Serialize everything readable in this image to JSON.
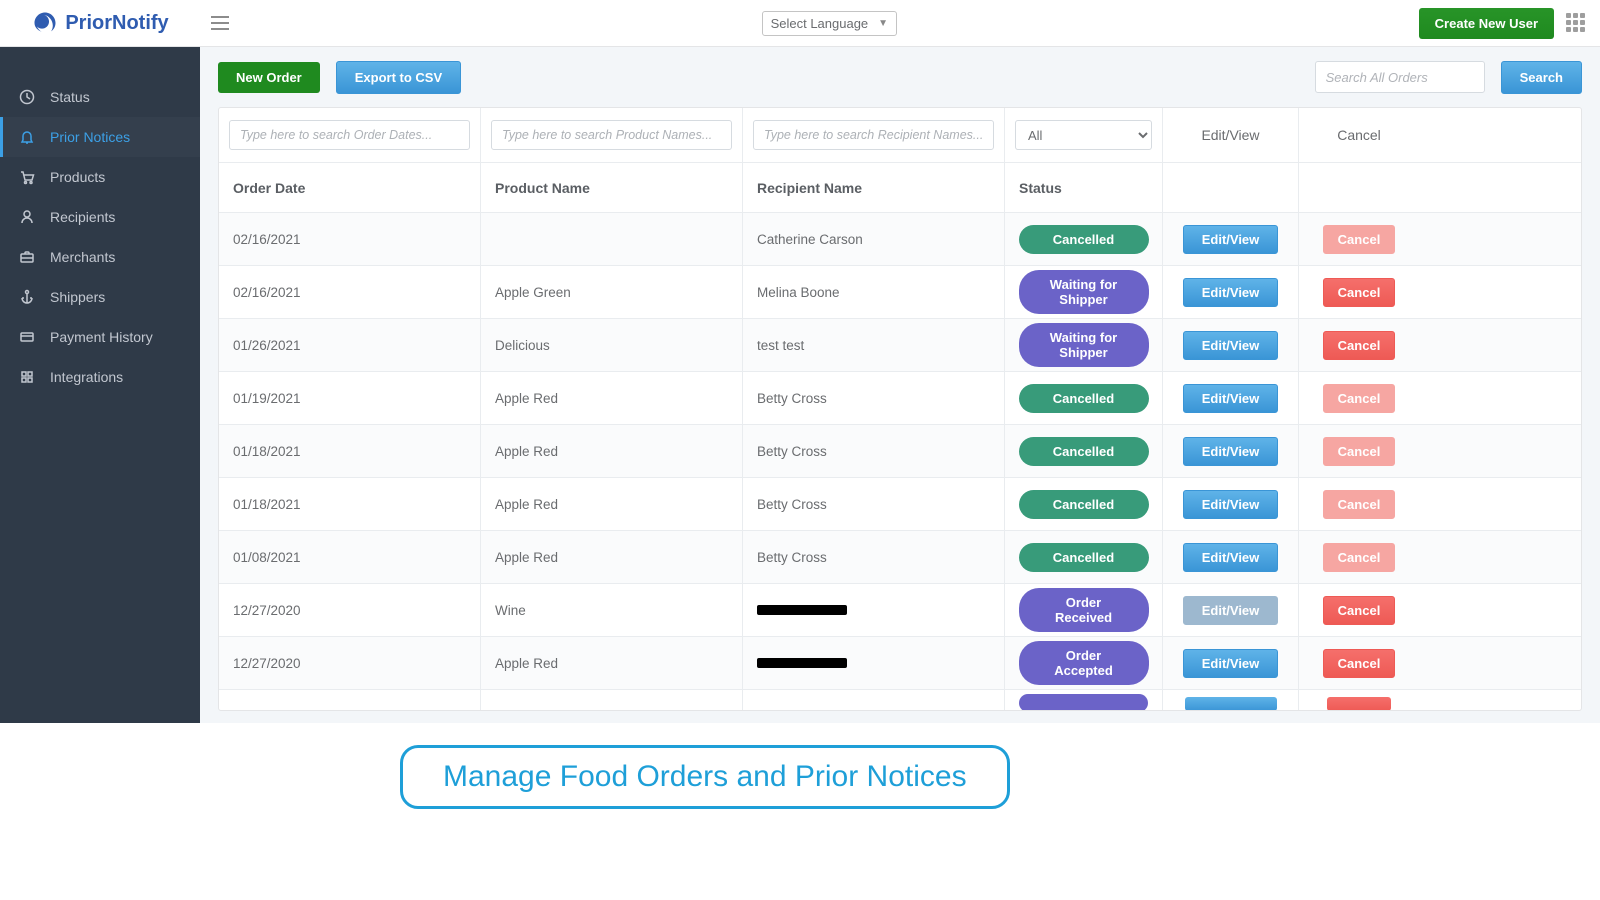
{
  "brand": "PriorNotify",
  "topbar": {
    "language_label": "Select Language",
    "create_user_label": "Create New User"
  },
  "sidebar": {
    "items": [
      {
        "label": "Status",
        "icon": "status"
      },
      {
        "label": "Prior Notices",
        "icon": "bell",
        "active": true
      },
      {
        "label": "Products",
        "icon": "cart"
      },
      {
        "label": "Recipients",
        "icon": "user"
      },
      {
        "label": "Merchants",
        "icon": "briefcase"
      },
      {
        "label": "Shippers",
        "icon": "anchor"
      },
      {
        "label": "Payment History",
        "icon": "card"
      },
      {
        "label": "Integrations",
        "icon": "puzzle"
      }
    ]
  },
  "toolbar": {
    "new_order_label": "New Order",
    "export_csv_label": "Export to CSV",
    "search_placeholder": "Search All Orders",
    "search_button_label": "Search"
  },
  "filters": {
    "order_date_placeholder": "Type here to search Order Dates...",
    "product_name_placeholder": "Type here to search Product Names...",
    "recipient_name_placeholder": "Type here to search Recipient Names...",
    "status_selected": "All"
  },
  "headers": {
    "order_date": "Order Date",
    "product_name": "Product Name",
    "recipient_name": "Recipient Name",
    "status": "Status",
    "edit_view": "Edit/View",
    "cancel": "Cancel"
  },
  "statuses": {
    "cancelled": "Cancelled",
    "waiting_shipper": "Waiting for Shipper",
    "order_received": "Order Received",
    "order_accepted": "Order Accepted"
  },
  "buttons": {
    "edit_view": "Edit/View",
    "cancel": "Cancel"
  },
  "rows": [
    {
      "date": "02/16/2021",
      "product": "",
      "recipient": "Catherine Carson",
      "status": "cancelled",
      "edit_disabled": false,
      "cancel_disabled": true,
      "redacted": false
    },
    {
      "date": "02/16/2021",
      "product": "Apple Green",
      "recipient": "Melina Boone",
      "status": "waiting_shipper",
      "edit_disabled": false,
      "cancel_disabled": false,
      "redacted": false
    },
    {
      "date": "01/26/2021",
      "product": "Delicious",
      "recipient": "test test",
      "status": "waiting_shipper",
      "edit_disabled": false,
      "cancel_disabled": false,
      "redacted": false
    },
    {
      "date": "01/19/2021",
      "product": "Apple Red",
      "recipient": "Betty Cross",
      "status": "cancelled",
      "edit_disabled": false,
      "cancel_disabled": true,
      "redacted": false
    },
    {
      "date": "01/18/2021",
      "product": "Apple Red",
      "recipient": "Betty Cross",
      "status": "cancelled",
      "edit_disabled": false,
      "cancel_disabled": true,
      "redacted": false
    },
    {
      "date": "01/18/2021",
      "product": "Apple Red",
      "recipient": "Betty Cross",
      "status": "cancelled",
      "edit_disabled": false,
      "cancel_disabled": true,
      "redacted": false
    },
    {
      "date": "01/08/2021",
      "product": "Apple Red",
      "recipient": "Betty Cross",
      "status": "cancelled",
      "edit_disabled": false,
      "cancel_disabled": true,
      "redacted": false
    },
    {
      "date": "12/27/2020",
      "product": "Wine",
      "recipient": "",
      "status": "order_received",
      "edit_disabled": true,
      "cancel_disabled": false,
      "redacted": true
    },
    {
      "date": "12/27/2020",
      "product": "Apple Red",
      "recipient": "",
      "status": "order_accepted",
      "edit_disabled": false,
      "cancel_disabled": false,
      "redacted": true
    }
  ],
  "callout": "Manage Food Orders and Prior Notices"
}
